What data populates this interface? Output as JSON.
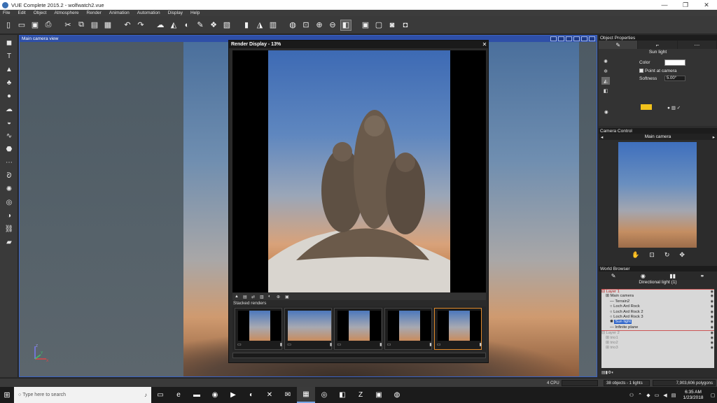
{
  "window": {
    "title": "VUE Complete 2015.2 - wolfwatch2.vue",
    "minimize": "—",
    "maximize": "❐",
    "close": "✕"
  },
  "menu": [
    "File",
    "Edit",
    "Object",
    "Atmosphere",
    "Render",
    "Animation",
    "Automation",
    "Display",
    "Help"
  ],
  "viewport": {
    "title": "Main camera view",
    "axis": {
      "x": "X",
      "y": "Y",
      "z": "Z"
    }
  },
  "render_display": {
    "title": "Render Display - 13%",
    "stacked_label": "Stacked renders",
    "thumbnails": 5,
    "selected_thumbnail": 5
  },
  "object_properties": {
    "header": "Object Properties",
    "object_name": "Sun light",
    "color_label": "Color",
    "point_at_camera_label": "Point at camera",
    "point_at_camera_checked": true,
    "softness_label": "Softness",
    "softness_value": "5.00°",
    "light_color": "#f2c21c"
  },
  "camera_control": {
    "header": "Camera Control",
    "camera_name": "Main camera"
  },
  "world_browser": {
    "header": "World Browser",
    "selection": "Directional light (1)",
    "tree": [
      {
        "label": "Layer 1",
        "type": "layer"
      },
      {
        "label": "Main camera",
        "type": "item",
        "indent": 1
      },
      {
        "label": "Terrain2",
        "type": "item",
        "indent": 2
      },
      {
        "label": "Loch Ard Rock",
        "type": "item",
        "indent": 2
      },
      {
        "label": "Loch Ard Rock 2",
        "type": "item",
        "indent": 2
      },
      {
        "label": "Loch Ard Rock 3",
        "type": "item",
        "indent": 2
      },
      {
        "label": "Sun light",
        "type": "selected",
        "indent": 2
      },
      {
        "label": "Infinite plane",
        "type": "item",
        "indent": 2
      },
      {
        "label": "Layer 2",
        "type": "layer-dim"
      },
      {
        "label": "trio1",
        "type": "dim",
        "indent": 1
      },
      {
        "label": "trio2",
        "type": "dim",
        "indent": 1
      },
      {
        "label": "trio3",
        "type": "dim",
        "indent": 1
      }
    ]
  },
  "status": {
    "cpu": "4 CPU",
    "objects": "38 objects - 1 lights",
    "polygons": "7,903,606 polygons"
  },
  "taskbar": {
    "search_placeholder": "Type here to search",
    "time": "6:35 AM",
    "date": "1/23/2018"
  }
}
